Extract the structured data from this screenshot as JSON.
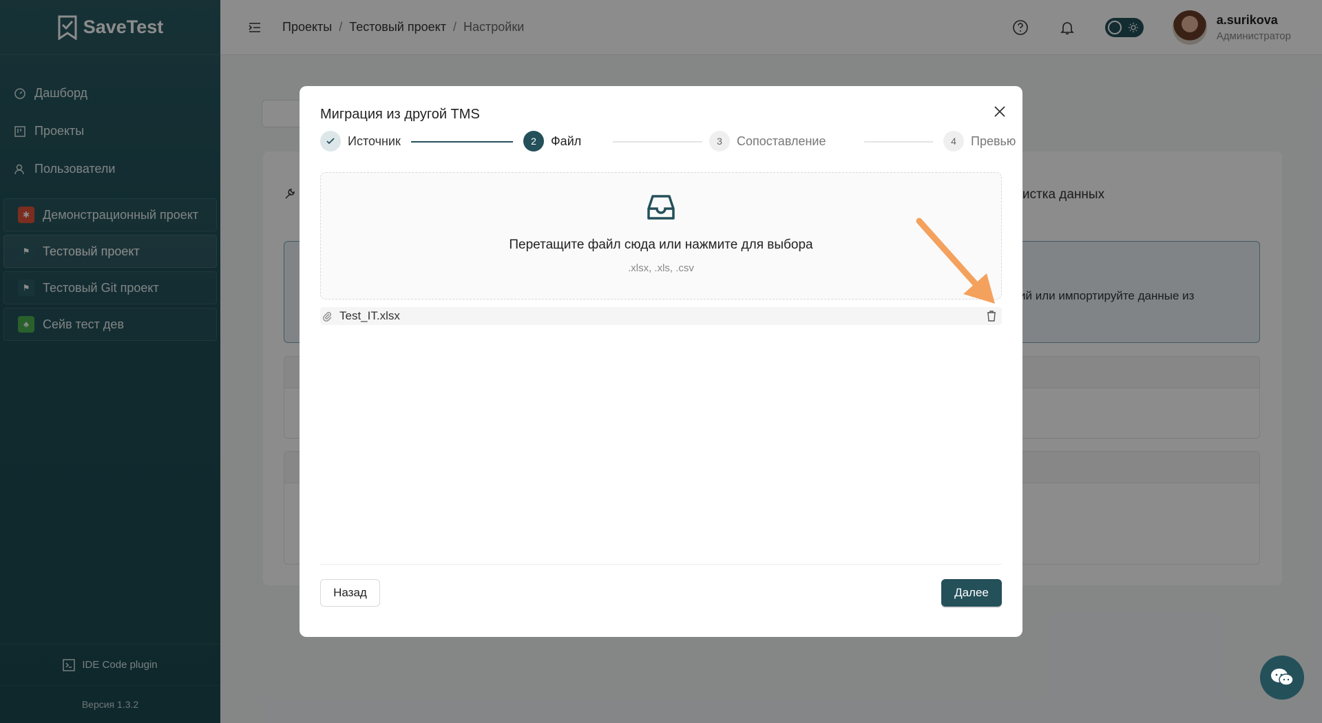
{
  "app": {
    "name": "SaveTest"
  },
  "sidebar": {
    "nav": [
      {
        "label": "Дашборд",
        "icon": "dashboard-icon"
      },
      {
        "label": "Проекты",
        "icon": "projects-icon"
      },
      {
        "label": "Пользователи",
        "icon": "users-icon"
      }
    ],
    "projects": [
      {
        "label": "Демонстрационный проект",
        "icon": "bug-icon",
        "color": "#e0533a"
      },
      {
        "label": "Тестовый проект",
        "icon": "flag-icon",
        "color": "#2f5f66",
        "active": true
      },
      {
        "label": "Тестовый Git проект",
        "icon": "flag-icon",
        "color": "#2f5f66"
      },
      {
        "label": "Сейв тест дев",
        "icon": "plant-icon",
        "color": "#4caf50"
      }
    ],
    "ide_plugin": "IDE Code plugin",
    "version": "Версия 1.3.2"
  },
  "header": {
    "breadcrumbs": [
      "Проекты",
      "Тестовый проект",
      "Настройки"
    ],
    "user": {
      "name": "a.surikova",
      "role": "Администратор"
    }
  },
  "background": {
    "tab_partial": "чистка данных",
    "info_partial": "ий или импортируйте данные из"
  },
  "modal": {
    "title": "Миграция из другой TMS",
    "steps": [
      {
        "num": "",
        "label": "Источник",
        "state": "done"
      },
      {
        "num": "2",
        "label": "Файл",
        "state": "active"
      },
      {
        "num": "3",
        "label": "Сопоставление",
        "state": "todo"
      },
      {
        "num": "4",
        "label": "Превью",
        "state": "todo"
      }
    ],
    "dropzone": {
      "text": "Перетащите файл сюда или нажмите для выбора",
      "hint": ".xlsx, .xls, .csv"
    },
    "file": {
      "name": "Test_IT.xlsx"
    },
    "back_label": "Назад",
    "next_label": "Далее"
  },
  "colors": {
    "primary": "#24505a",
    "annotation_arrow": "#f4a15d"
  }
}
